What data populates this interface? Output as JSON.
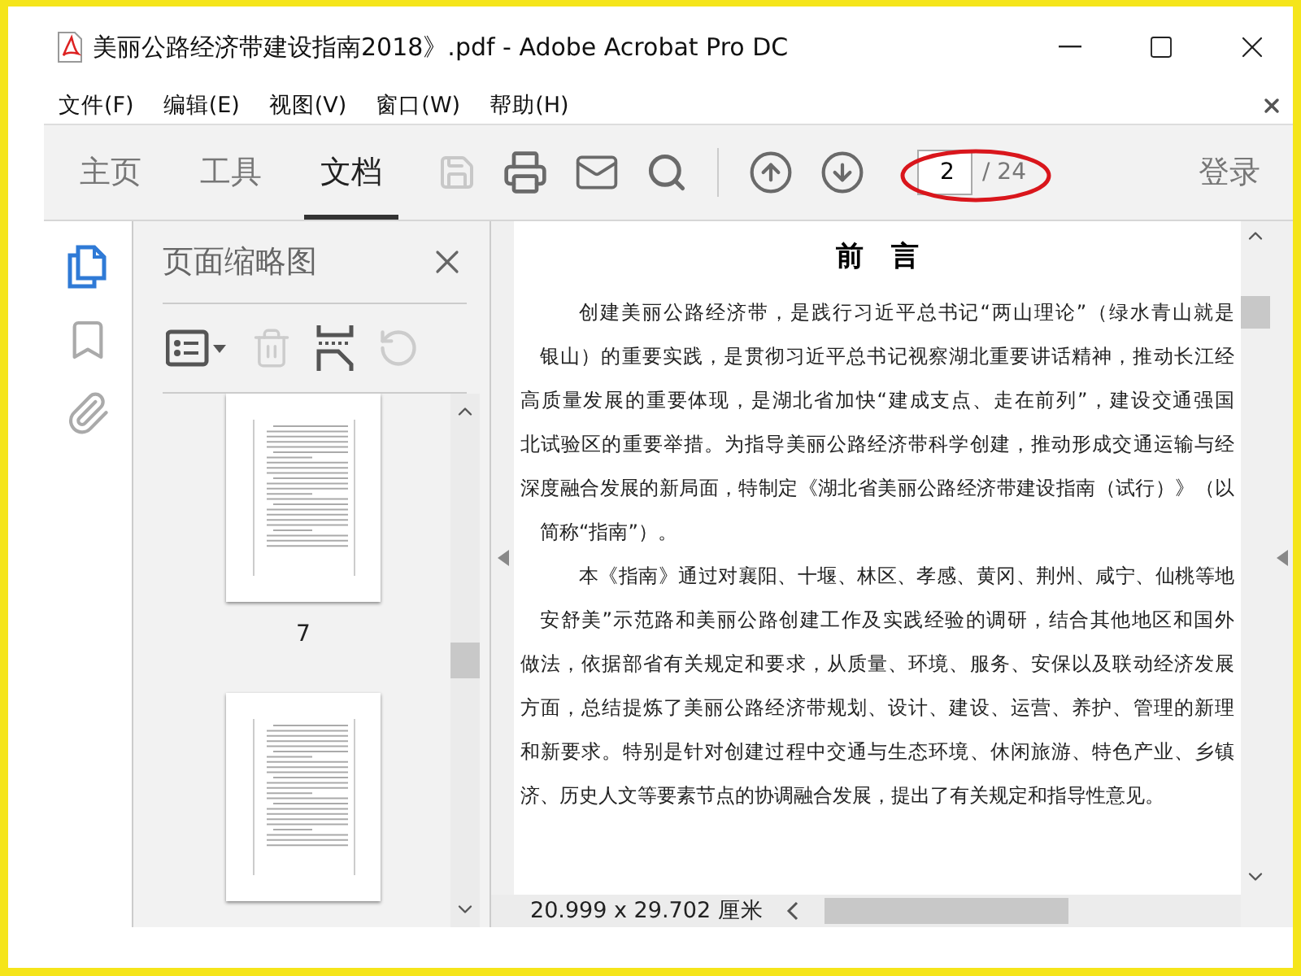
{
  "window": {
    "title": "美丽公路经济带建设指南2018》.pdf - Adobe Acrobat Pro DC"
  },
  "menu": [
    "文件(F)",
    "编辑(E)",
    "视图(V)",
    "窗口(W)",
    "帮助(H)"
  ],
  "tabs": [
    {
      "label": "主页",
      "selected": false
    },
    {
      "label": "工具",
      "selected": false
    },
    {
      "label": "文档",
      "selected": true
    }
  ],
  "tools": [
    {
      "kind": "save",
      "disabled": true
    },
    {
      "kind": "print",
      "disabled": false
    },
    {
      "kind": "mail",
      "disabled": false
    },
    {
      "kind": "search",
      "disabled": false
    }
  ],
  "nav": [
    {
      "kind": "up"
    },
    {
      "kind": "down"
    }
  ],
  "page_field": {
    "value": "2",
    "total": "/ 24"
  },
  "login": "登录",
  "rail": [
    {
      "kind": "pages",
      "selected": true
    },
    {
      "kind": "bookmark",
      "selected": false
    },
    {
      "kind": "attachment",
      "selected": false
    }
  ],
  "panel": {
    "title": "页面缩略图",
    "tools": [
      {
        "kind": "options",
        "disabled": false
      },
      {
        "kind": "trash",
        "disabled": true
      },
      {
        "kind": "insert",
        "disabled": false
      },
      {
        "kind": "rotate",
        "disabled": true
      }
    ],
    "thumbnails": [
      {
        "label": "7",
        "selected": false
      },
      {
        "selected": false
      }
    ]
  },
  "document": {
    "heading": "前　言",
    "lines": [
      {
        "kind": "first",
        "text": "创建美丽公路经济带，是践行习近平总书记“两山理论”（绿水青山就是"
      },
      {
        "kind": "wrap",
        "text": "银山）的重要实践，是贯彻习近平总书记视察湖北重要讲话精神，推动长江经"
      },
      {
        "kind": "plain",
        "text": "高质量发展的重要体现，是湖北省加快“建成支点、走在前列”，建设交通强国"
      },
      {
        "kind": "plain",
        "text": "北试验区的重要举措。为指导美丽公路经济带科学创建，推动形成交通运输与经"
      },
      {
        "kind": "plain",
        "text": "深度融合发展的新局面，特制定《湖北省美丽公路经济带建设指南（试行）》（以"
      },
      {
        "kind": "wrap-end",
        "text": "简称“指南”）。"
      },
      {
        "kind": "first",
        "text": "本《指南》通过对襄阳、十堰、林区、孝感、黄冈、荆州、咸宁、仙桃等地"
      },
      {
        "kind": "wrap",
        "text": "安舒美”示范路和美丽公路创建工作及实践经验的调研，结合其他地区和国外"
      },
      {
        "kind": "plain",
        "text": "做法，依据部省有关规定和要求，从质量、环境、服务、安保以及联动经济发展"
      },
      {
        "kind": "plain",
        "text": "方面，总结提炼了美丽公路经济带规划、设计、建设、运营、养护、管理的新理"
      },
      {
        "kind": "plain",
        "text": "和新要求。特别是针对创建过程中交通与生态环境、休闲旅游、特色产业、乡镇"
      },
      {
        "kind": "end",
        "text": "济、历史人文等要素节点的协调融合发展，提出了有关规定和指导性意见。"
      }
    ]
  },
  "status": "20.999 x 29.702 厘米"
}
